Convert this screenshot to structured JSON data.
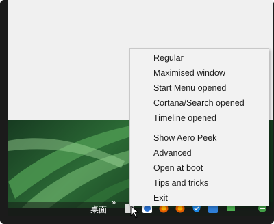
{
  "taskbar": {
    "desktop_label": "桌面",
    "overflow_chevron": "»"
  },
  "menu": {
    "items_group1": [
      "Regular",
      "Maximised window",
      "Start Menu opened",
      "Cortana/Search opened",
      "Timeline opened"
    ],
    "items_group2": [
      "Show Aero Peek",
      "Advanced",
      "Open at boot",
      "Tips and tricks",
      "Exit"
    ]
  },
  "tray_icons": [
    {
      "name": "tray-app-icon",
      "color": "#e6e6e6"
    },
    {
      "name": "cloud-icon",
      "color": "#2b74d6"
    },
    {
      "name": "firefox-icon",
      "color": "#e66000"
    },
    {
      "name": "shield-icon",
      "color": "#1e88e5"
    },
    {
      "name": "window-icon",
      "color": "#2f7fd8"
    },
    {
      "name": "network-icon",
      "color": "#4caf50"
    }
  ],
  "colors": {
    "menu_background": "#f2f2f2",
    "window_background": "#f0f0f0"
  }
}
